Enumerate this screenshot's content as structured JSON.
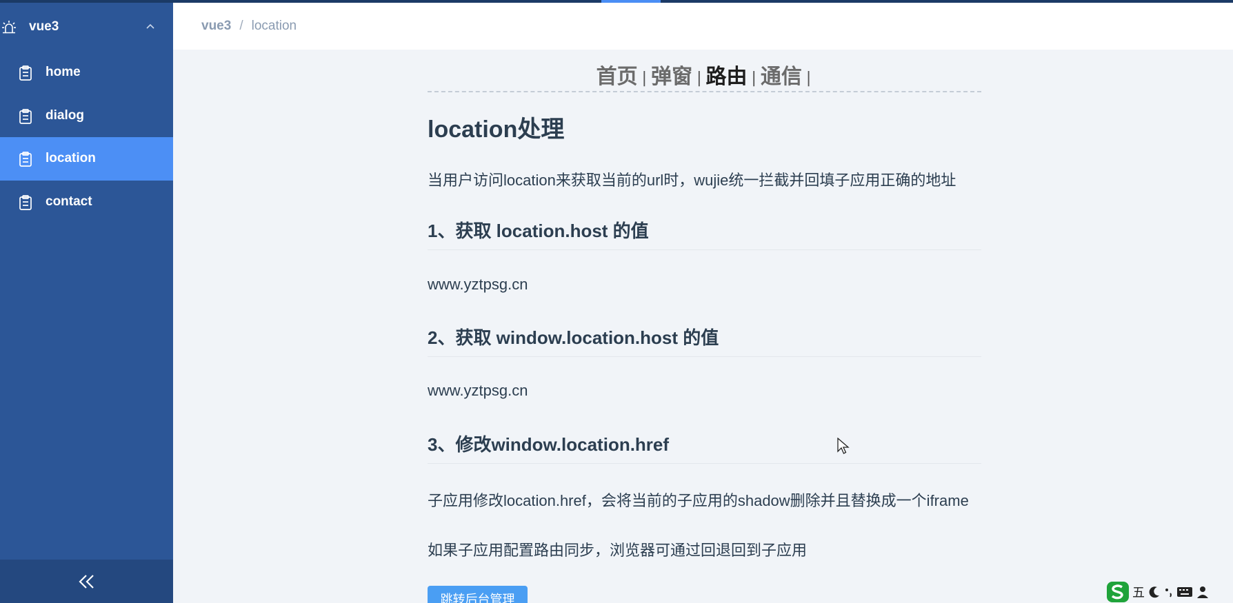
{
  "sidebar": {
    "app_title": "vue3",
    "items": [
      {
        "label": "home",
        "active": false
      },
      {
        "label": "dialog",
        "active": false
      },
      {
        "label": "location",
        "active": true
      },
      {
        "label": "contact",
        "active": false
      }
    ]
  },
  "breadcrumb": {
    "root": "vue3",
    "separator": "/",
    "current": "location"
  },
  "nav": {
    "links": [
      "首页",
      "弹窗",
      "路由",
      "通信"
    ],
    "current_index": 2,
    "separator": "|"
  },
  "article": {
    "title": "location处理",
    "intro": "当用户访问location来获取当前的url时，wujie统一拦截并回填子应用正确的地址",
    "sections": [
      {
        "heading": "1、获取 location.host 的值",
        "value": "www.yztpsg.cn"
      },
      {
        "heading": "2、获取 window.location.host 的值",
        "value": "www.yztpsg.cn"
      },
      {
        "heading": "3、修改window.location.href",
        "value": "子应用修改location.href，会将当前的子应用的shadow删除并且替换成一个iframe"
      }
    ],
    "note": "如果子应用配置路由同步，浏览器可通过回退回到子应用",
    "button_label": "跳转后台管理"
  },
  "ime": {
    "mode_char": "五"
  },
  "colors": {
    "sidebar_bg": "#2c5697",
    "sidebar_active": "#4c8ff5",
    "collapse_bg": "#24487f",
    "content_bg": "#f1f4f8",
    "button_bg": "#4a9ef3"
  },
  "icons": {
    "header": "bug-icon",
    "menu_item": "clipboard-icon",
    "collapse": "double-chevron-left-icon"
  }
}
